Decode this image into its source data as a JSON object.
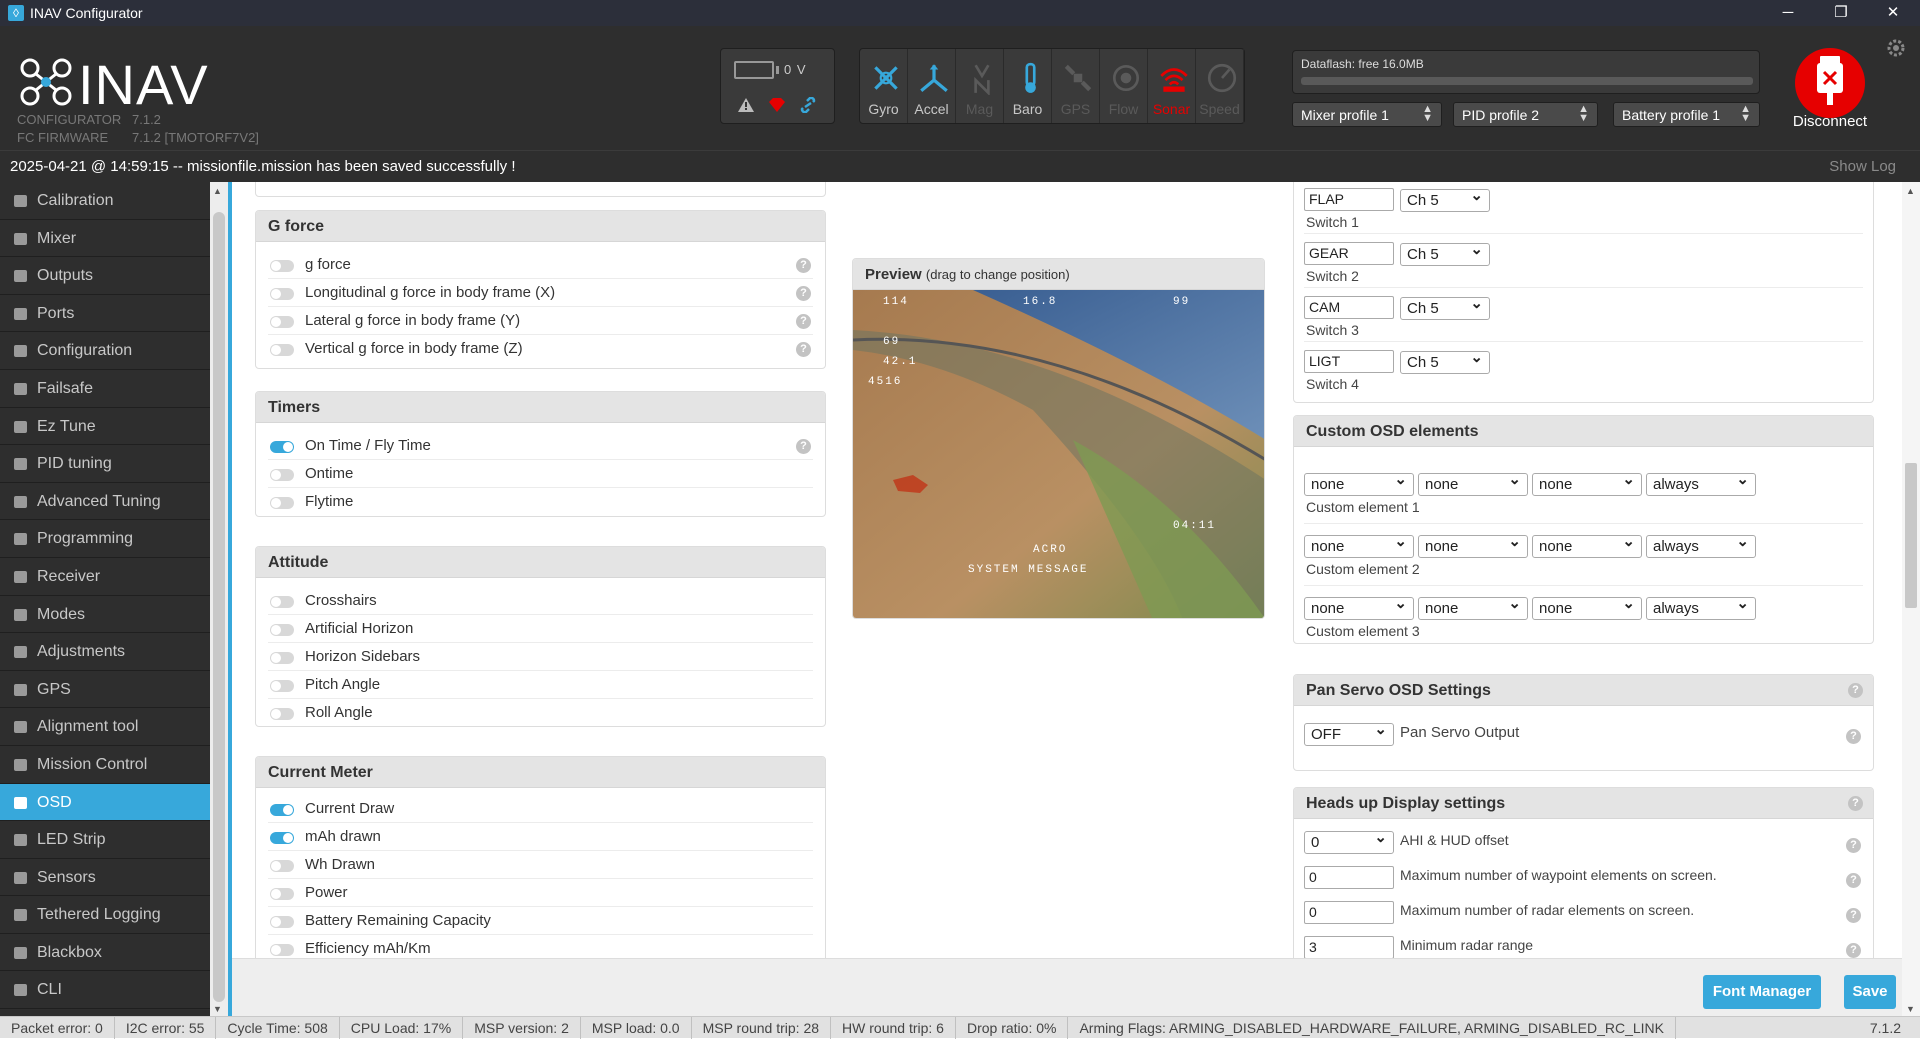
{
  "window": {
    "title": "INAV Configurator",
    "minimize": "─",
    "restore": "❐",
    "close": "✕"
  },
  "header": {
    "logo_text": "INAV",
    "configurator_label": "CONFIGURATOR",
    "configurator_version": "7.1.2",
    "firmware_label": "FC FIRMWARE",
    "firmware_version": "7.1.2 [TMOTORF7V2]",
    "battery_voltage": "0 V",
    "sensors": [
      {
        "label": "Gyro",
        "icon": "gyro-icon",
        "active": true
      },
      {
        "label": "Accel",
        "icon": "accel-icon",
        "active": true
      },
      {
        "label": "Mag",
        "icon": "mag-icon",
        "active": false
      },
      {
        "label": "Baro",
        "icon": "baro-icon",
        "active": true
      },
      {
        "label": "GPS",
        "icon": "gps-icon",
        "active": false
      },
      {
        "label": "Flow",
        "icon": "flow-icon",
        "active": false
      },
      {
        "label": "Sonar",
        "icon": "sonar-icon",
        "active": "error"
      },
      {
        "label": "Speed",
        "icon": "speed-icon",
        "active": false
      }
    ],
    "dataflash": "Dataflash: free 16.0MB",
    "mixer_profile": "Mixer profile 1",
    "pid_profile": "PID profile 2",
    "battery_profile": "Battery profile 1",
    "disconnect": "Disconnect"
  },
  "status_message": "2025-04-21 @ 14:59:15 -- missionfile.mission has been saved successfully !",
  "show_log": "Show Log",
  "sidebar": [
    {
      "label": "Calibration",
      "active": false
    },
    {
      "label": "Mixer",
      "active": false
    },
    {
      "label": "Outputs",
      "active": false
    },
    {
      "label": "Ports",
      "active": false
    },
    {
      "label": "Configuration",
      "active": false
    },
    {
      "label": "Failsafe",
      "active": false
    },
    {
      "label": "Ez Tune",
      "active": false
    },
    {
      "label": "PID tuning",
      "active": false
    },
    {
      "label": "Advanced Tuning",
      "active": false
    },
    {
      "label": "Programming",
      "active": false
    },
    {
      "label": "Receiver",
      "active": false
    },
    {
      "label": "Modes",
      "active": false
    },
    {
      "label": "Adjustments",
      "active": false
    },
    {
      "label": "GPS",
      "active": false
    },
    {
      "label": "Alignment tool",
      "active": false
    },
    {
      "label": "Mission Control",
      "active": false
    },
    {
      "label": "OSD",
      "active": true
    },
    {
      "label": "LED Strip",
      "active": false
    },
    {
      "label": "Sensors",
      "active": false
    },
    {
      "label": "Tethered Logging",
      "active": false
    },
    {
      "label": "Blackbox",
      "active": false
    },
    {
      "label": "CLI",
      "active": false
    }
  ],
  "gforce": {
    "title": "G force",
    "items": [
      {
        "label": "g force",
        "on": false
      },
      {
        "label": "Longitudinal g force in body frame (X)",
        "on": false
      },
      {
        "label": "Lateral g force in body frame (Y)",
        "on": false
      },
      {
        "label": "Vertical g force in body frame (Z)",
        "on": false
      }
    ]
  },
  "timers": {
    "title": "Timers",
    "items": [
      {
        "label": "On Time / Fly Time",
        "on": true
      },
      {
        "label": "Ontime",
        "on": false
      },
      {
        "label": "Flytime",
        "on": false
      }
    ]
  },
  "attitude": {
    "title": "Attitude",
    "items": [
      {
        "label": "Crosshairs",
        "on": false
      },
      {
        "label": "Artificial Horizon",
        "on": false
      },
      {
        "label": "Horizon Sidebars",
        "on": false
      },
      {
        "label": "Pitch Angle",
        "on": false
      },
      {
        "label": "Roll Angle",
        "on": false
      }
    ]
  },
  "current_meter": {
    "title": "Current Meter",
    "items": [
      {
        "label": "Current Draw",
        "on": true
      },
      {
        "label": "mAh drawn",
        "on": true
      },
      {
        "label": "Wh Drawn",
        "on": false
      },
      {
        "label": "Power",
        "on": false
      },
      {
        "label": "Battery Remaining Capacity",
        "on": false
      },
      {
        "label": "Efficiency mAh/Km",
        "on": false
      }
    ]
  },
  "preview": {
    "title": "Preview",
    "hint": "(drag to change position)",
    "osd": {
      "top_left": "114",
      "battery": "16.8",
      "rssi": "99",
      "alt": "69",
      "dist": "42.1",
      "speed": "4516",
      "flytime": "04:11",
      "mode": "ACRO",
      "message": "SYSTEM MESSAGE"
    }
  },
  "switches": [
    {
      "name": "FLAP",
      "channel": "Ch 5",
      "label": "Switch 1"
    },
    {
      "name": "GEAR",
      "channel": "Ch 5",
      "label": "Switch 2"
    },
    {
      "name": "CAM",
      "channel": "Ch 5",
      "label": "Switch 3"
    },
    {
      "name": "LIGT",
      "channel": "Ch 5",
      "label": "Switch 4"
    }
  ],
  "custom_osd": {
    "title": "Custom OSD elements",
    "elements": [
      {
        "label": "Custom element 1",
        "values": [
          "none",
          "none",
          "none",
          "always"
        ]
      },
      {
        "label": "Custom element 2",
        "values": [
          "none",
          "none",
          "none",
          "always"
        ]
      },
      {
        "label": "Custom element 3",
        "values": [
          "none",
          "none",
          "none",
          "always"
        ]
      }
    ]
  },
  "pan_servo": {
    "title": "Pan Servo OSD Settings",
    "value": "OFF",
    "label": "Pan Servo Output"
  },
  "hud": {
    "title": "Heads up Display settings",
    "rows": [
      {
        "value": "0",
        "label": "AHI & HUD offset",
        "type": "select"
      },
      {
        "value": "0",
        "label": "Maximum number of waypoint elements on screen.",
        "type": "input"
      },
      {
        "value": "0",
        "label": "Maximum number of radar elements on screen.",
        "type": "input"
      },
      {
        "value": "3",
        "label": "Minimum radar range",
        "type": "input"
      }
    ]
  },
  "buttons": {
    "font_manager": "Font Manager",
    "save": "Save"
  },
  "statusbar": {
    "packet_error": "Packet error: 0",
    "i2c_error": "I2C error: 55",
    "cycle_time": "Cycle Time: 508",
    "cpu_load": "CPU Load: 17%",
    "msp_version": "MSP version: 2",
    "msp_load": "MSP load: 0.0",
    "msp_round_trip": "MSP round trip: 28",
    "hw_round_trip": "HW round trip: 6",
    "drop_ratio": "Drop ratio: 0%",
    "arming_flags": "Arming Flags: ARMING_DISABLED_HARDWARE_FAILURE, ARMING_DISABLED_RC_LINK",
    "version": "7.1.2"
  },
  "colors": {
    "accent": "#37a8db",
    "header_bg": "#2e2e2e",
    "disconnect_red": "#e60000",
    "active_sensor": "#37a8db",
    "error_sensor": "#e60000"
  }
}
